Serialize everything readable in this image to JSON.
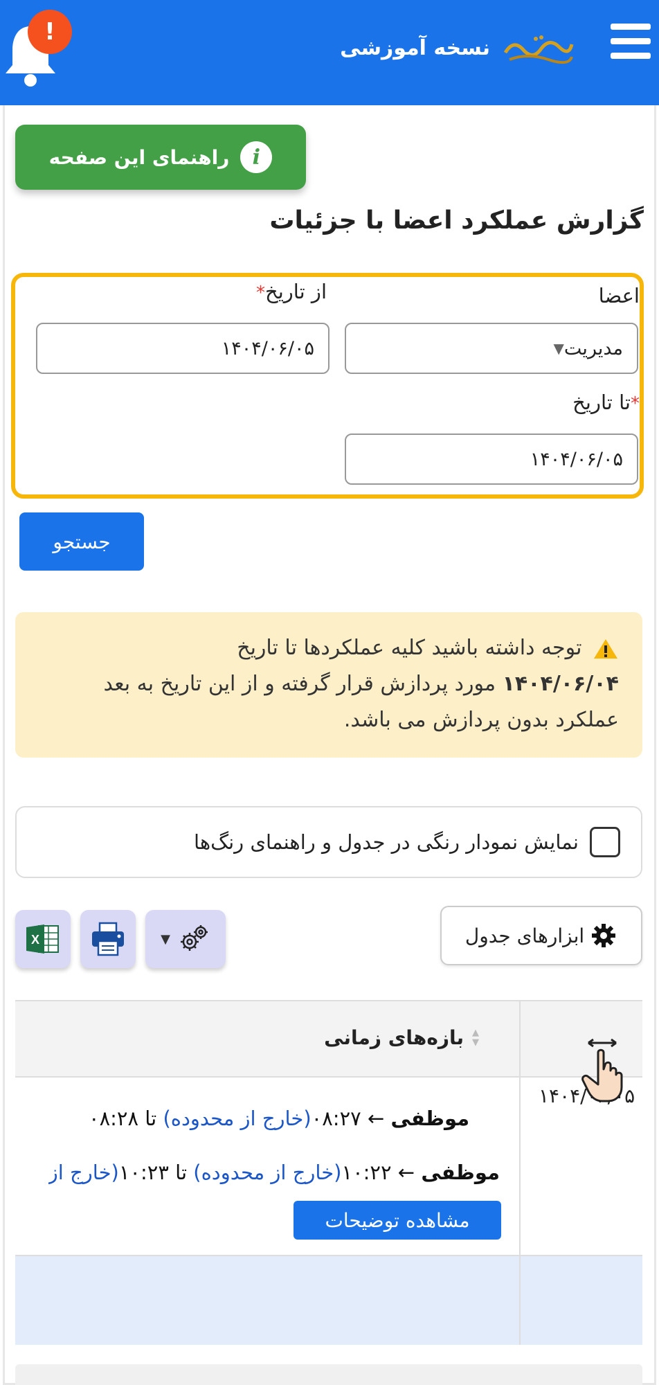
{
  "header": {
    "title": "نسخه آموزشی",
    "notification_badge": "!",
    "brand_color": "#1a73e8"
  },
  "guide_button": {
    "label": "راهنمای این صفحه",
    "icon": "i"
  },
  "page": {
    "title": "گزارش عملکرد اعضا با جزئیات"
  },
  "filters": {
    "members_label": "اعضا",
    "members_value": "مدیریت",
    "from_label": "از تاریخ",
    "from_value": "۱۴۰۴/۰۶/۰۵",
    "to_label": "تا تاریخ",
    "to_value": "۱۴۰۴/۰۶/۰۵",
    "required_mark": "*"
  },
  "search_button": {
    "label": "جستجو"
  },
  "notice": {
    "line1": "توجه داشته باشید کلیه عملکردها تا تاریخ",
    "date": "۱۴۰۴/۰۶/۰۴",
    "line2": "مورد پردازش قرار گرفته و از این تاریخ به بعد",
    "line3": "عملکرد بدون پردازش می باشد."
  },
  "color_toggle": {
    "label": "نمایش نمودار رنگی در جدول و راهنمای رنگ‌ها",
    "checked": false
  },
  "toolbar": {
    "tools_label": "ابزارهای جدول",
    "settings_caret": "▼"
  },
  "table": {
    "header_period": "بازه‌های زمانی",
    "rows": [
      {
        "date": "۱۴۰۴/۰۶/۰۵",
        "entries": [
          {
            "status": "موظفی",
            "arrow": "←",
            "start": "۰۸:۲۷",
            "start_note": "(خارج از محدوده)",
            "to_word": "تا",
            "end": "۰۸:۲۸",
            "end_note": ""
          },
          {
            "status": "موظفی",
            "arrow": "←",
            "start": "۱۰:۲۲",
            "start_note": "(خارج از محدوده)",
            "to_word": "تا",
            "end": "۱۰:۲۳",
            "end_note": "(خارج از"
          }
        ],
        "details_button": "مشاهده توضیحات"
      }
    ]
  }
}
